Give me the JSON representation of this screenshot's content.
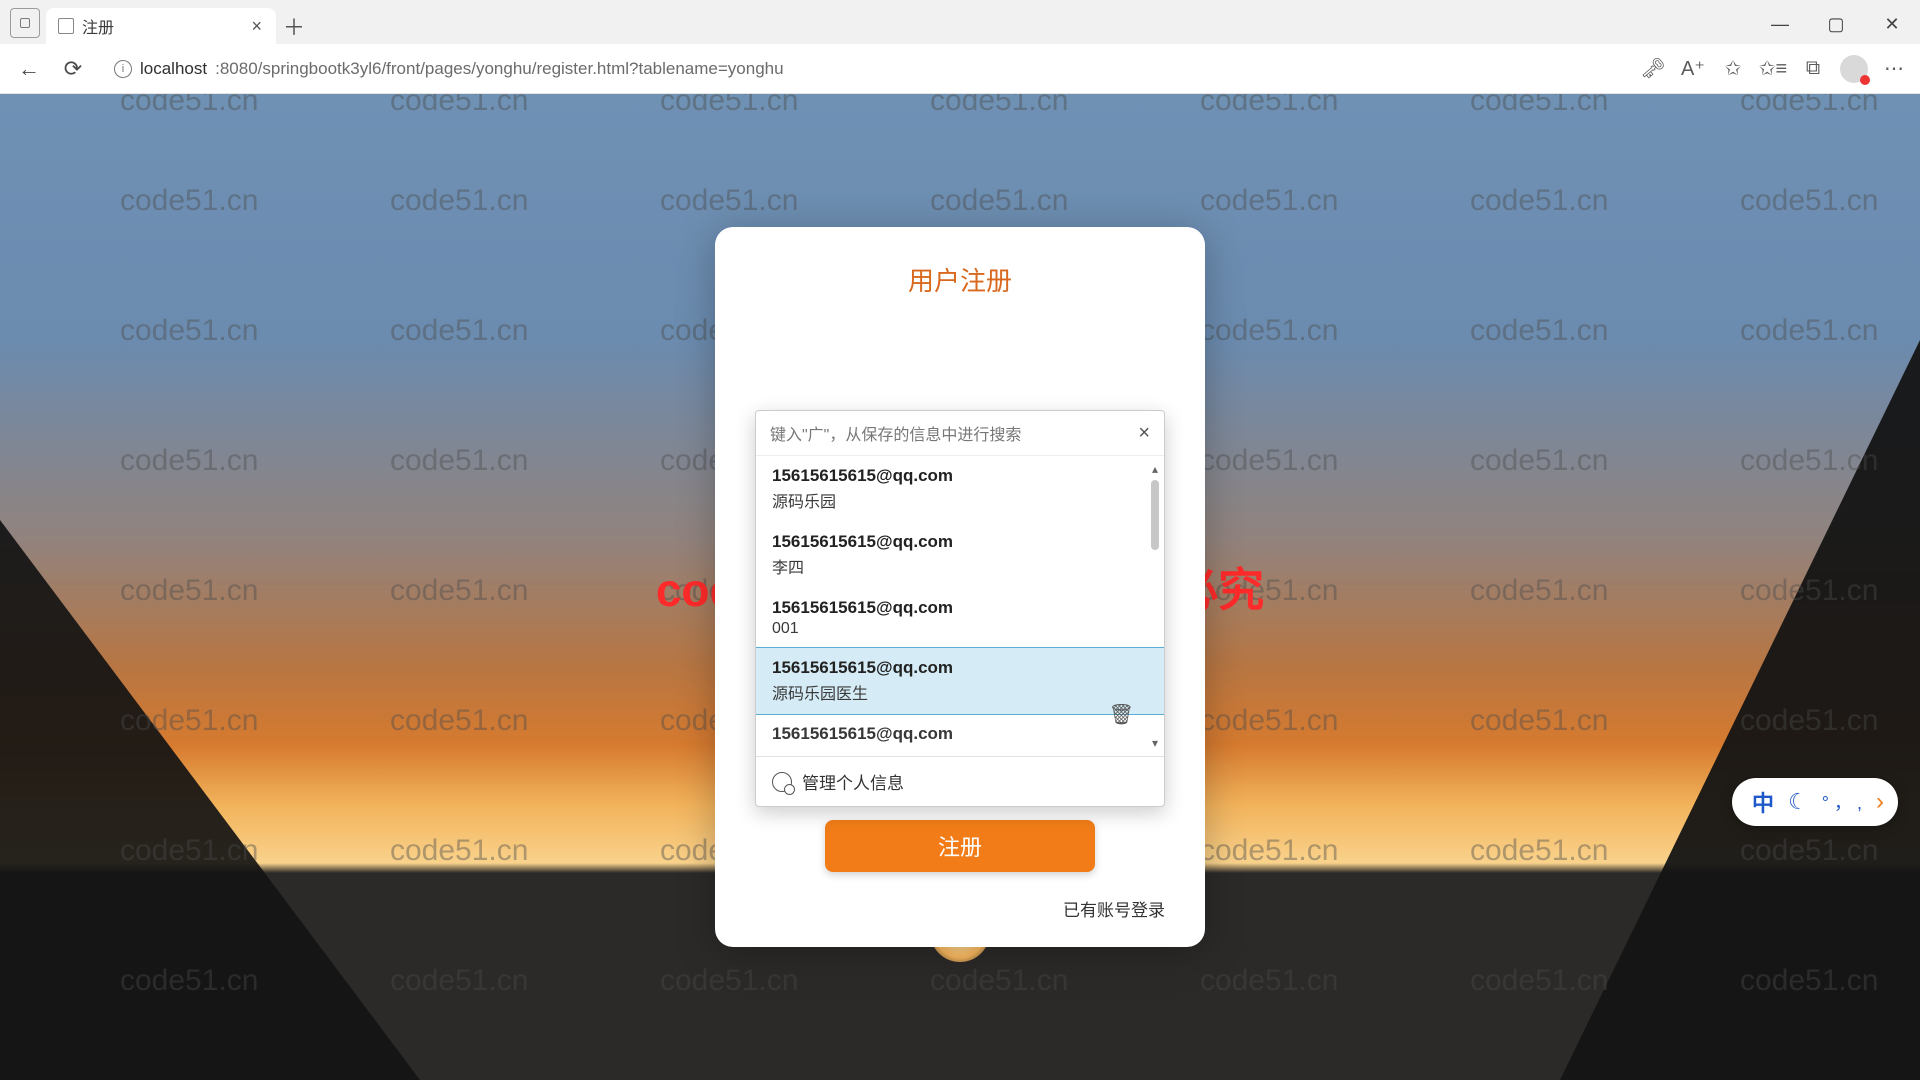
{
  "browser": {
    "tab_title": "注册",
    "url_host": "localhost",
    "url_rest": ":8080/springbootk3yl6/front/pages/yonghu/register.html?tablename=yonghu"
  },
  "watermark": {
    "tile": "code51.cn",
    "banner": "code51.cn-源码乐园盗图必究"
  },
  "card": {
    "title": "用户注册",
    "email_value": "15615615615@qq.com",
    "submit_label": "注册",
    "login_link": "已有账号登录"
  },
  "dropdown": {
    "hint": "键入\"广\"，从保存的信息中进行搜索",
    "manage_label": "管理个人信息",
    "items": [
      {
        "line1": "15615615615@qq.com",
        "line2": "源码乐园",
        "selected": false
      },
      {
        "line1": "15615615615@qq.com",
        "line2": "李四",
        "selected": false
      },
      {
        "line1": "15615615615@qq.com",
        "line2": "001",
        "selected": false
      },
      {
        "line1": "15615615615@qq.com",
        "line2": "源码乐园医生",
        "selected": true
      },
      {
        "line1": "15615615615@qq.com",
        "line2": "",
        "selected": false,
        "partial": true
      }
    ]
  },
  "ime": {
    "t1": "中",
    "t2": "🌙",
    "t3": "° ， ,",
    "arrow": "›"
  }
}
